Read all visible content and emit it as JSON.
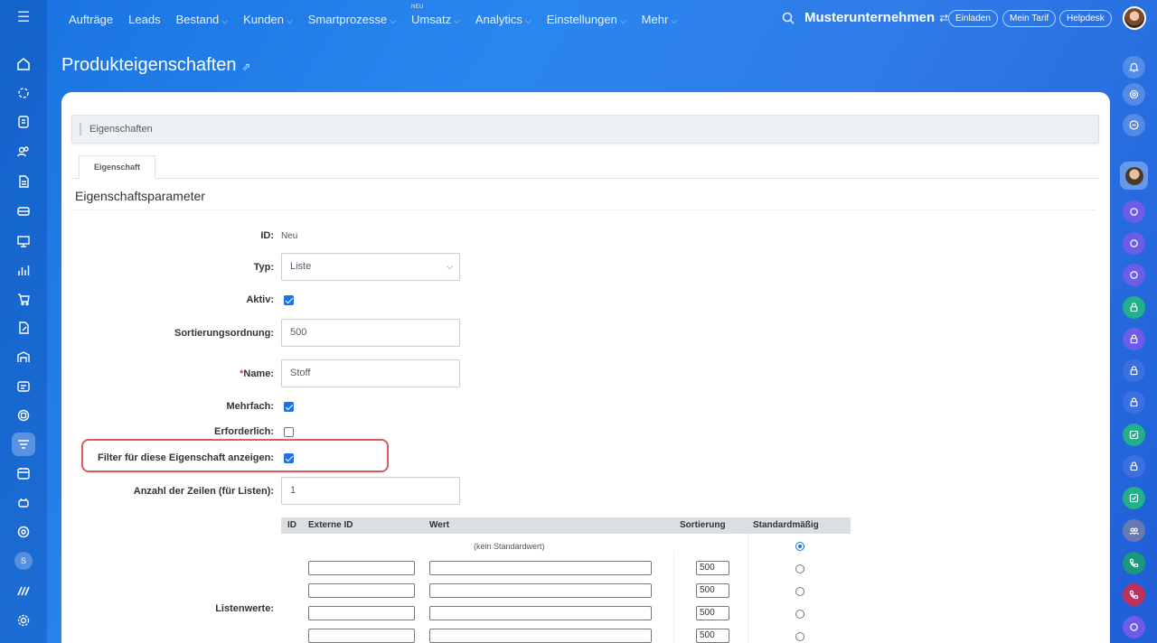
{
  "nav": {
    "items": [
      {
        "label": "Aufträge",
        "chevron": false
      },
      {
        "label": "Leads",
        "chevron": false
      },
      {
        "label": "Bestand",
        "chevron": true
      },
      {
        "label": "Kunden",
        "chevron": true
      },
      {
        "label": "Smartprozesse",
        "chevron": true
      },
      {
        "label": "Umsatz",
        "chevron": true,
        "badge": "NEU"
      },
      {
        "label": "Analytics",
        "chevron": true
      },
      {
        "label": "Einstellungen",
        "chevron": true
      },
      {
        "label": "Mehr",
        "chevron": true
      }
    ],
    "company": "Musterunternehmen",
    "invite": "Einladen",
    "plan": "Mein Tarif",
    "helpdesk": "Helpdesk"
  },
  "page": {
    "title": "Produkteigenschaften"
  },
  "section": {
    "header": "Eigenschaften",
    "tab": "Eigenschaft",
    "params_title": "Eigenschaftsparameter"
  },
  "form": {
    "id_label": "ID:",
    "id_value": "Neu",
    "type_label": "Typ:",
    "type_value": "Liste",
    "active_label": "Aktiv:",
    "active": true,
    "sort_label": "Sortierungsordnung:",
    "sort_value": "500",
    "name_required": "*",
    "name_label": "Name:",
    "name_value": "Stoff",
    "multiple_label": "Mehrfach:",
    "multiple": true,
    "required_label": "Erforderlich:",
    "required": false,
    "filter_label": "Filter für diese Eigenschaft anzeigen:",
    "filter": true,
    "rows_label": "Anzahl der Zeilen (für Listen):",
    "rows_value": "1",
    "list_values_label": "Listenwerte:"
  },
  "list_values": {
    "headers": [
      "ID",
      "Externe ID",
      "Wert",
      "Sortierung",
      "Standardmäßig"
    ],
    "no_default": "(kein Standardwert)",
    "rows": [
      {
        "sort": "500"
      },
      {
        "sort": "500"
      },
      {
        "sort": "500"
      },
      {
        "sort": "500"
      }
    ]
  },
  "colors": {
    "accent": "#1a73e8",
    "highlight": "#e05a5a"
  }
}
